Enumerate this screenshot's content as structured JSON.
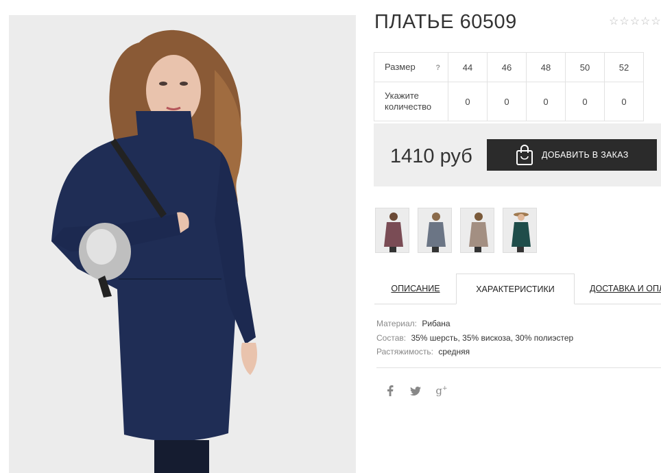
{
  "product": {
    "title": "ПЛАТЬЕ 60509",
    "rating_stars": 5,
    "rating_value": 0
  },
  "sizes": {
    "label": "Размер",
    "help": "?",
    "qty_label": "Укажите количество",
    "values": [
      "44",
      "46",
      "48",
      "50",
      "52"
    ],
    "quantities": [
      "0",
      "0",
      "0",
      "0",
      "0"
    ]
  },
  "buy": {
    "price": "1410 руб",
    "button_label": "ДОБАВИТЬ В ЗАКАЗ"
  },
  "thumbnails": [
    {
      "color": "#7a4c55",
      "name": "thumb-burgundy"
    },
    {
      "color": "#6b7585",
      "name": "thumb-grey"
    },
    {
      "color": "#a38f82",
      "name": "thumb-beige"
    },
    {
      "color": "#1f4d4a",
      "name": "thumb-green"
    }
  ],
  "tabs": {
    "description": "ОПИСАНИЕ",
    "characteristics": "ХАРАКТЕРИСТИКИ",
    "delivery": "ДОСТАВКА И ОПЛ"
  },
  "characteristics": [
    {
      "key": "Материал:",
      "value": "Рибана"
    },
    {
      "key": "Состав:",
      "value": "35% шерсть, 35% вискоза, 30% полиэстер"
    },
    {
      "key": "Растяжимость:",
      "value": "средняя"
    }
  ],
  "social": [
    "facebook-icon",
    "twitter-icon",
    "google-plus-icon"
  ],
  "colors": {
    "dress": "#1f2d55",
    "button_bg": "#2b2b2b",
    "box_bg": "#eeeeee"
  }
}
